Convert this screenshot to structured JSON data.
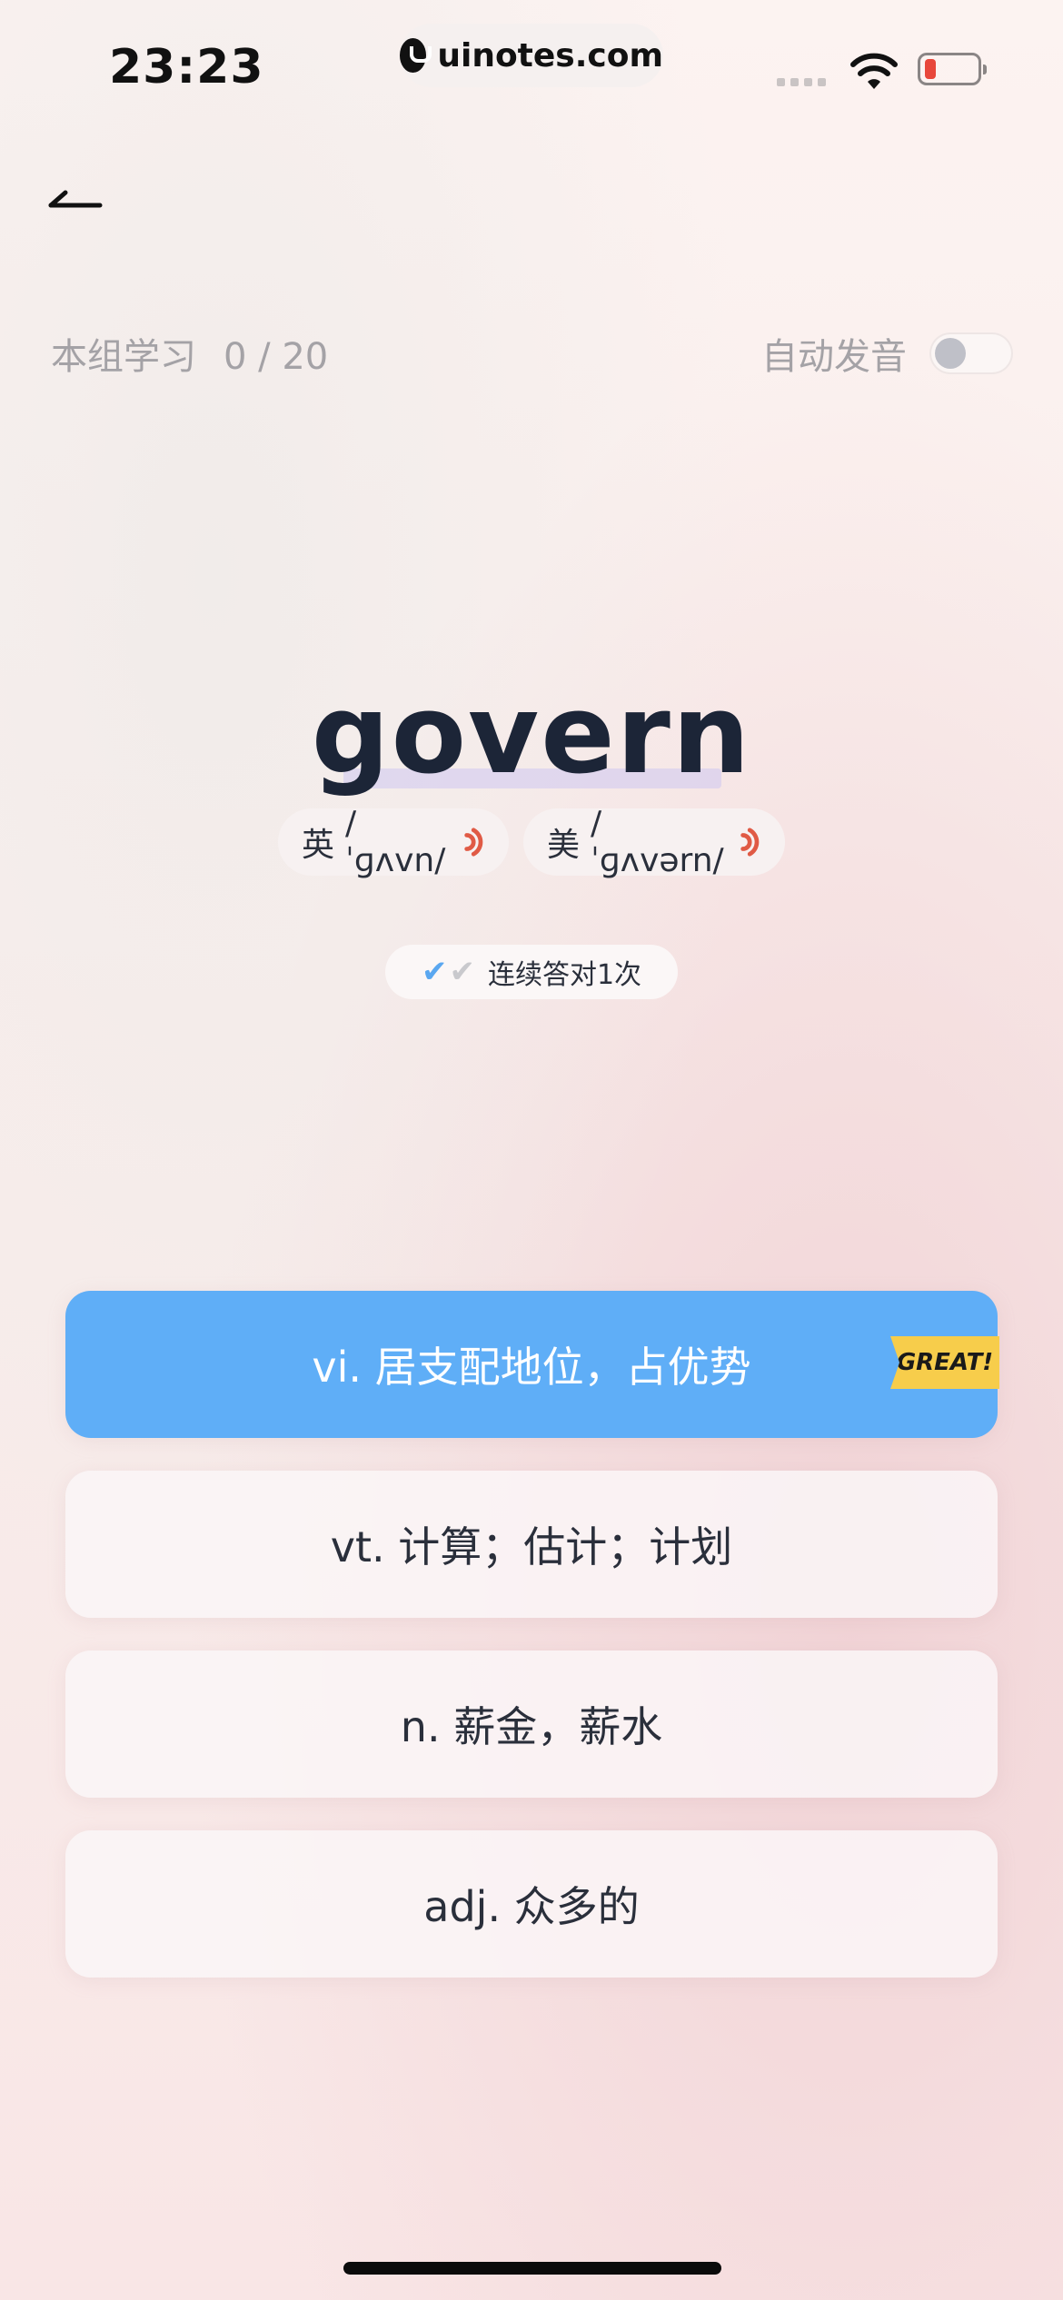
{
  "status_bar": {
    "time": "23:23",
    "url": "uinotes.com",
    "battery_color": "#e8473b"
  },
  "header": {
    "back_icon": "back-arrow-icon"
  },
  "progress": {
    "label": "本组学习",
    "count": "0 / 20",
    "auto_pronounce_label": "自动发音",
    "auto_pronounce_on": false
  },
  "word": {
    "text": "govern",
    "uk": {
      "label": "英",
      "phonetic": "/ˈɡʌvn/"
    },
    "us": {
      "label": "美",
      "phonetic": "/ˈɡʌvərn/"
    },
    "sound_icon_color": "#e05a45"
  },
  "streak": {
    "text": "连续答对1次"
  },
  "options": [
    {
      "text": "vi. 居支配地位，占优势",
      "state": "correct",
      "badge": "GREAT!"
    },
    {
      "text": "vt. 计算；估计；计划"
    },
    {
      "text": "n. 薪金，薪水"
    },
    {
      "text": "adj. 众多的"
    }
  ],
  "colors": {
    "correct": "#5faef7",
    "badge": "#f7cd4b",
    "word": "#1c2537"
  }
}
